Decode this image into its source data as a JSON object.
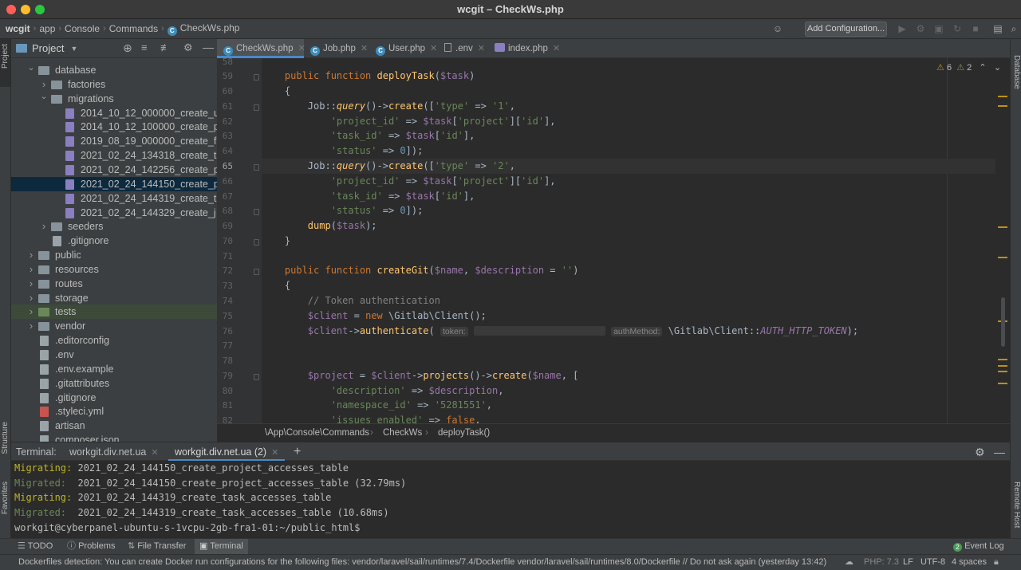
{
  "window": {
    "title": "wcgit – CheckWs.php"
  },
  "nav": {
    "breadcrumbs": [
      "wcgit",
      "app",
      "Console",
      "Commands",
      "CheckWs.php"
    ],
    "add_config": "Add Configuration..."
  },
  "project": {
    "title": "Project",
    "tree": [
      {
        "label": "database",
        "level": 1,
        "type": "folder",
        "open": true
      },
      {
        "label": "factories",
        "level": 2,
        "type": "folder"
      },
      {
        "label": "migrations",
        "level": 2,
        "type": "folder",
        "open": true
      },
      {
        "label": "2014_10_12_000000_create_u",
        "level": 3,
        "type": "php"
      },
      {
        "label": "2014_10_12_100000_create_p",
        "level": 3,
        "type": "php"
      },
      {
        "label": "2019_08_19_000000_create_f",
        "level": 3,
        "type": "php"
      },
      {
        "label": "2021_02_24_134318_create_t",
        "level": 3,
        "type": "php"
      },
      {
        "label": "2021_02_24_142256_create_p",
        "level": 3,
        "type": "php"
      },
      {
        "label": "2021_02_24_144150_create_p",
        "level": 3,
        "type": "php",
        "selected": true
      },
      {
        "label": "2021_02_24_144319_create_t",
        "level": 3,
        "type": "php"
      },
      {
        "label": "2021_02_24_144329_create_j",
        "level": 3,
        "type": "php"
      },
      {
        "label": "seeders",
        "level": 2,
        "type": "folder"
      },
      {
        "label": ".gitignore",
        "level": 2,
        "type": "file"
      },
      {
        "label": "public",
        "level": 1,
        "type": "folder"
      },
      {
        "label": "resources",
        "level": 1,
        "type": "folder"
      },
      {
        "label": "routes",
        "level": 1,
        "type": "folder"
      },
      {
        "label": "storage",
        "level": 1,
        "type": "folder"
      },
      {
        "label": "tests",
        "level": 1,
        "type": "folder-green",
        "highlight": true
      },
      {
        "label": "vendor",
        "level": 1,
        "type": "folder"
      },
      {
        "label": ".editorconfig",
        "level": 1,
        "type": "file"
      },
      {
        "label": ".env",
        "level": 1,
        "type": "file"
      },
      {
        "label": ".env.example",
        "level": 1,
        "type": "file"
      },
      {
        "label": ".gitattributes",
        "level": 1,
        "type": "file"
      },
      {
        "label": ".gitignore",
        "level": 1,
        "type": "file"
      },
      {
        "label": ".styleci.yml",
        "level": 1,
        "type": "yml"
      },
      {
        "label": "artisan",
        "level": 1,
        "type": "file"
      },
      {
        "label": "composer.json",
        "level": 1,
        "type": "file"
      }
    ]
  },
  "tabs": [
    {
      "label": "CheckWs.php",
      "active": true
    },
    {
      "label": "Job.php"
    },
    {
      "label": "User.php"
    },
    {
      "label": ".env"
    },
    {
      "label": "index.php"
    }
  ],
  "editor": {
    "warnings": "6",
    "weak_warnings": "2",
    "current_line": "65",
    "lines": [
      {
        "n": "58",
        "html": ""
      },
      {
        "n": "59",
        "html": "    <span class='kw'>public function </span><span class='fn'>deployTask</span>(<span class='var'>$task</span>)"
      },
      {
        "n": "60",
        "html": "    {"
      },
      {
        "n": "61",
        "html": "        Job::<span class='mi'>query</span>()-><span class='fn'>create</span>([<span class='str'>'type'</span> => <span class='str'>'1'</span>,"
      },
      {
        "n": "62",
        "html": "            <span class='str'>'project_id'</span> => <span class='var'>$task</span>[<span class='str'>'project'</span>][<span class='str'>'id'</span>],"
      },
      {
        "n": "63",
        "html": "            <span class='str'>'task_id'</span> => <span class='var'>$task</span>[<span class='str'>'id'</span>],"
      },
      {
        "n": "64",
        "html": "            <span class='str'>'status'</span> => <span class='num'>0</span>]);"
      },
      {
        "n": "65",
        "html": "        Job::<span class='mi'>query</span>()-><span class='fn'>create</span>([<span class='str'>'type'</span> => <span class='str'>'2'</span>,"
      },
      {
        "n": "66",
        "html": "            <span class='str'>'project_id'</span> => <span class='var'>$task</span>[<span class='str'>'project'</span>][<span class='str'>'id'</span>],"
      },
      {
        "n": "67",
        "html": "            <span class='str'>'task_id'</span> => <span class='var'>$task</span>[<span class='str'>'id'</span>],"
      },
      {
        "n": "68",
        "html": "            <span class='str'>'status'</span> => <span class='num'>0</span>]);"
      },
      {
        "n": "69",
        "html": "        <span class='fn'>dump</span>(<span class='var'>$task</span>);"
      },
      {
        "n": "70",
        "html": "    }"
      },
      {
        "n": "71",
        "html": ""
      },
      {
        "n": "72",
        "html": "    <span class='kw'>public function </span><span class='fn'>createGit</span>(<span class='var'>$name</span>, <span class='var'>$description</span> = <span class='str'>''</span>)"
      },
      {
        "n": "73",
        "html": "    {"
      },
      {
        "n": "74",
        "html": "        <span class='cmt'>// Token authentication</span>"
      },
      {
        "n": "75",
        "html": "        <span class='var'>$client</span> = <span class='kw'>new </span>\\Gitlab\\Client();"
      },
      {
        "n": "76",
        "html": "        <span class='var'>$client</span>-><span class='fn'>authenticate</span>( <span class='hint'>token:</span> <span class='blur'></span> <span class='hint'>authMethod:</span> \\Gitlab\\Client::<span class='const'>AUTH_HTTP_TOKEN</span>);"
      },
      {
        "n": "77",
        "html": ""
      },
      {
        "n": "78",
        "html": ""
      },
      {
        "n": "79",
        "html": "        <span class='var'>$project</span> = <span class='var'>$client</span>-><span class='fn'>projects</span>()-><span class='fn'>create</span>(<span class='var'>$name</span>, ["
      },
      {
        "n": "80",
        "html": "            <span class='str'>'description'</span> => <span class='var'>$description</span>,"
      },
      {
        "n": "81",
        "html": "            <span class='str'>'namespace_id'</span> => <span class='str'>'5281551'</span>,"
      },
      {
        "n": "82",
        "html": "            <span class='str'>'issues_enabled'</span> => <span class='kw'>false</span>,"
      }
    ],
    "breadcrumb": [
      "\\App\\Console\\Commands",
      "CheckWs",
      "deployTask()"
    ]
  },
  "terminal": {
    "label": "Terminal:",
    "tabs": [
      "workgit.div.net.ua",
      "workgit.div.net.ua (2)"
    ],
    "add": "+",
    "lines": [
      {
        "prefix": "Migrating:",
        "text": " 2021_02_24_144150_create_project_accesses_table"
      },
      {
        "prefix": "Migrated:",
        "text": "  2021_02_24_144150_create_project_accesses_table (32.79ms)"
      },
      {
        "prefix": "Migrating:",
        "text": " 2021_02_24_144319_create_task_accesses_table"
      },
      {
        "prefix": "Migrated:",
        "text": "  2021_02_24_144319_create_task_accesses_table (10.68ms)"
      },
      {
        "prefix": "",
        "text": "workgit@cyberpanel-ubuntu-s-1vcpu-2gb-fra1-01:~/public_html$"
      }
    ]
  },
  "toolwindows": [
    "TODO",
    "Problems",
    "File Transfer",
    "Terminal"
  ],
  "event_log": "Event Log",
  "side": {
    "project": "Project",
    "structure": "Structure",
    "favorites": "Favorites",
    "database": "Database",
    "remote_host": "Remote Host"
  },
  "status": {
    "message": "Dockerfiles detection: You can create Docker run configurations for the following files: vendor/laravel/sail/runtimes/7.4/Dockerfile vendor/laravel/sail/runtimes/8.0/Dockerfile // Do not ask again (yesterday 13:42)",
    "php": "PHP: 7.3",
    "line_sep": "LF",
    "encoding": "UTF-8",
    "indent": "4 spaces"
  },
  "colors": {
    "accent": "#4a88c7",
    "selection": "#0d293e",
    "warning": "#be9117"
  }
}
